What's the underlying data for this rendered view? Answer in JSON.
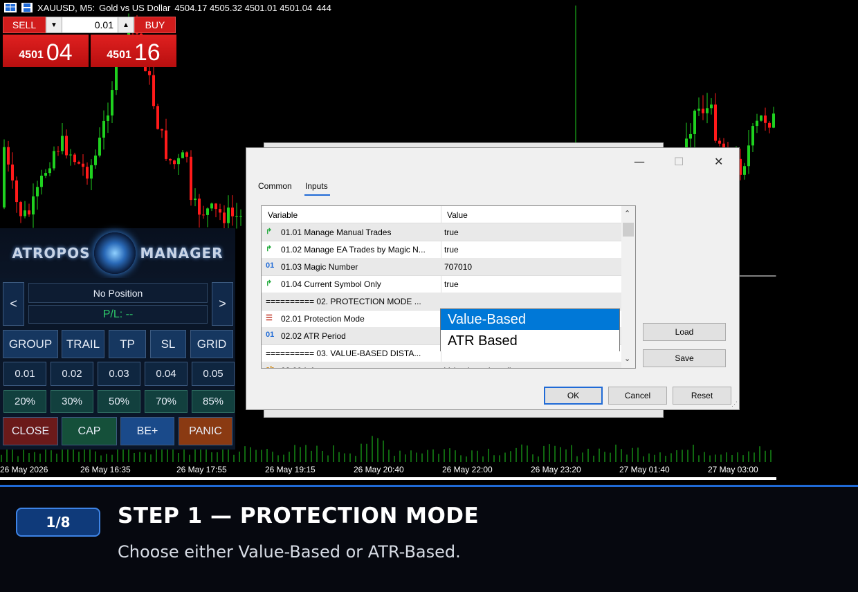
{
  "chart_header": {
    "symbol": "XAUUSD, M5:",
    "description": "Gold vs US Dollar",
    "ohlc": "4504.17 4505.32 4501.01 4501.04",
    "volume": "444"
  },
  "trade": {
    "sell_label": "SELL",
    "buy_label": "BUY",
    "lot": "0.01",
    "bid_prefix": "4501",
    "bid_big": "04",
    "ask_prefix": "4501",
    "ask_big": "16"
  },
  "logo": {
    "left": "ATROPOS",
    "right": "MANAGER"
  },
  "panel": {
    "prev": "<",
    "next": ">",
    "position": "No Position",
    "pl": "P/L: --",
    "modes": [
      "GROUP",
      "TRAIL",
      "TP",
      "SL",
      "GRID"
    ],
    "lots": [
      "0.01",
      "0.02",
      "0.03",
      "0.04",
      "0.05"
    ],
    "percents": [
      "20%",
      "30%",
      "50%",
      "70%",
      "85%"
    ],
    "actions": [
      {
        "label": "CLOSE",
        "color": "#6b1a1a"
      },
      {
        "label": "CAP",
        "color": "#15503a"
      },
      {
        "label": "BE+",
        "color": "#1a4a8a"
      },
      {
        "label": "PANIC",
        "color": "#8a3a12"
      }
    ]
  },
  "time_axis": [
    "26 May 2026",
    "26 May 16:35",
    "26 May 17:55",
    "26 May 19:15",
    "26 May 20:40",
    "26 May 22:00",
    "26 May 23:20",
    "27 May 01:40",
    "27 May 03:00"
  ],
  "dialog": {
    "tabs": [
      "Common",
      "Inputs"
    ],
    "active_tab": "Inputs",
    "col_variable": "Variable",
    "col_value": "Value",
    "rows": [
      {
        "icon": "bool-icon",
        "variable": "01.01 Manage Manual Trades",
        "value": "true"
      },
      {
        "icon": "bool-icon",
        "variable": "01.02 Manage EA Trades by Magic N...",
        "value": "true"
      },
      {
        "icon": "int-icon",
        "variable": "01.03 Magic Number",
        "value": "707010"
      },
      {
        "icon": "bool-icon",
        "variable": "01.04 Current Symbol Only",
        "value": "true"
      },
      {
        "icon": "none",
        "variable": "========== 02. PROTECTION MODE ...",
        "value": ""
      },
      {
        "icon": "enum-icon",
        "variable": "02.01 Protection Mode",
        "value": ""
      },
      {
        "icon": "int-icon",
        "variable": "02.02 ATR Period",
        "value": ""
      },
      {
        "icon": "none",
        "variable": "========== 03. VALUE-BASED DISTA...",
        "value": ""
      },
      {
        "icon": "string-icon",
        "variable": "03.00 Info",
        "value": "Value-based: trading..."
      }
    ],
    "dropdown_options": [
      "Value-Based",
      "ATR Based"
    ],
    "dropdown_selected": "Value-Based",
    "load": "Load",
    "save": "Save",
    "ok": "OK",
    "cancel": "Cancel",
    "reset": "Reset"
  },
  "step": {
    "badge": "1/8",
    "title": "STEP 1 — PROTECTION MODE",
    "description": "Choose either Value-Based or ATR-Based."
  }
}
